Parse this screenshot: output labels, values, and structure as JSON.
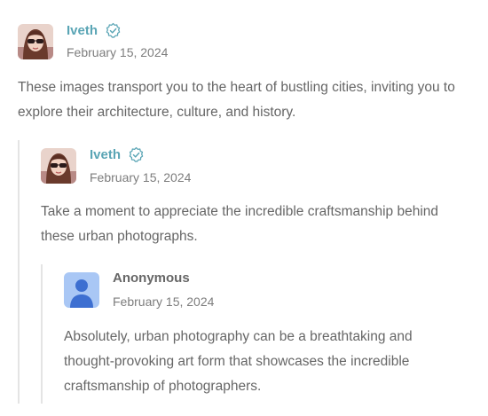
{
  "comments": [
    {
      "author": "Iveth",
      "verified": true,
      "date": "February 15, 2024",
      "avatar_icon": "user-photo-avatar",
      "text": "These images transport you to the heart of bustling cities, inviting you to explore their architecture, culture, and history."
    },
    {
      "author": "Iveth",
      "verified": true,
      "date": "February 15, 2024",
      "avatar_icon": "user-photo-avatar",
      "text": "Take a moment to appreciate the incredible craftsmanship behind these urban photographs."
    },
    {
      "author": "Anonymous",
      "verified": false,
      "date": "February 15, 2024",
      "avatar_icon": "default-person-avatar",
      "text": "Absolutely, urban photography can be a breathtaking and thought-provoking art form that showcases the incredible craftsmanship of photographers."
    }
  ],
  "colors": {
    "author_link": "#5aa5b5",
    "thread_line": "#e4e4e4",
    "default_avatar_bg": "#a9c7f5",
    "default_avatar_figure": "#3d6fd1"
  }
}
